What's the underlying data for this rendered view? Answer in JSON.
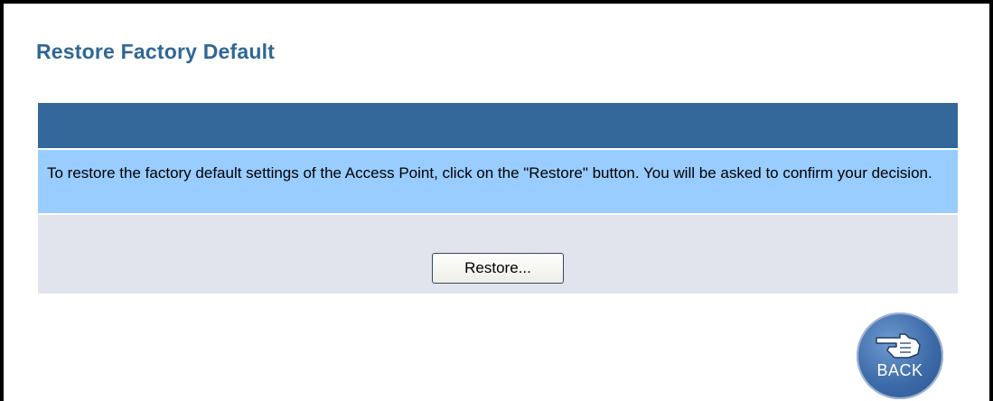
{
  "page": {
    "title": "Restore Factory Default"
  },
  "panel": {
    "message": "To restore the factory default settings of the Access Point, click on the \"Restore\" button. You will be asked to confirm your decision.",
    "restore_label": "Restore..."
  },
  "nav": {
    "back_label": "BACK",
    "back_icon": "pointing-hand-icon"
  },
  "colors": {
    "title": "#2f6796",
    "header_bar": "#34679a",
    "message_bg": "#99ccff",
    "actions_bg": "#e1e3ed",
    "back_button": "#3d6aa8"
  }
}
